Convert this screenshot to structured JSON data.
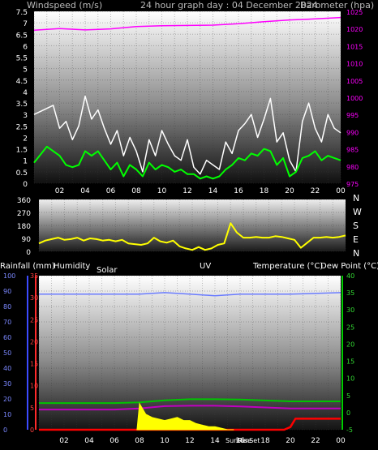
{
  "header": {
    "left": "Windspeed (m/s)",
    "center": "24 hour graph day : 04 December 2024",
    "right": "Barometer (hpa)"
  },
  "wind_panel_labels": {
    "compass": [
      "N",
      "W",
      "S",
      "E",
      "N"
    ]
  },
  "bottom_headers": {
    "rainfall": "Rainfall (mm)",
    "humidity": "Humidity",
    "solar": "Solar",
    "uv": "UV",
    "temperature": "Temperature (°C)",
    "dewpoint": "Dew Point (°C)"
  },
  "sun_labels": {
    "sunrise": "SunRise",
    "sunset": "SunSet"
  },
  "colors": {
    "wind_speed": "#ffffff",
    "wind_avg": "#00ff00",
    "barometer": "#ff00ff",
    "direction": "#ffff00",
    "humidity": "#6a7cff",
    "temperature": "#00c400",
    "dewpoint": "#c000c0",
    "rain": "#ff0000",
    "solar": "#ffff00",
    "uv": "#9aa2ff",
    "axis_left": "#ffffff",
    "axis_humidity": "#3c4bff",
    "axis_rain": "#ff2a2a",
    "axis_temp": "#00cc00"
  },
  "chart_data": [
    {
      "type": "line",
      "panel": "wind-barometer",
      "xlabel": "",
      "x_ticks": [
        "02",
        "04",
        "06",
        "08",
        "10",
        "12",
        "14",
        "16",
        "18",
        "20",
        "22",
        "00"
      ],
      "ylim_left": [
        0,
        7.5
      ],
      "y_ticks_left": [
        "0",
        "0.5",
        "1",
        "1.5",
        "2",
        "2.5",
        "3",
        "3.5",
        "4",
        "4.5",
        "5",
        "5.5",
        "6",
        "6.5",
        "7",
        "7.5"
      ],
      "ylim_right": [
        975,
        1025
      ],
      "y_ticks_right": [
        "975",
        "980",
        "985",
        "990",
        "995",
        "1000",
        "1005",
        "1010",
        "1015",
        "1020",
        "1025"
      ],
      "series": [
        {
          "key": "gust",
          "axis": "left",
          "hours": [
            0,
            1.5,
            2,
            2.5,
            3,
            3.5,
            4,
            4.5,
            5,
            5.5,
            6,
            6.5,
            7,
            7.5,
            8,
            8.5,
            9,
            9.5,
            10,
            10.5,
            11,
            11.5,
            12,
            12.5,
            13,
            13.5,
            14,
            14.5,
            15,
            15.5,
            16,
            16.5,
            17,
            17.5,
            18,
            18.5,
            19,
            19.5,
            20,
            20.5,
            21,
            21.5,
            22,
            22.5,
            23,
            23.5,
            24
          ],
          "values": [
            3.0,
            3.4,
            2.4,
            2.7,
            1.9,
            2.5,
            3.8,
            2.8,
            3.2,
            2.4,
            1.7,
            2.3,
            1.2,
            2.0,
            1.4,
            0.5,
            1.9,
            1.2,
            2.3,
            1.7,
            1.2,
            1.0,
            1.9,
            0.7,
            0.4,
            1.0,
            0.8,
            0.6,
            1.8,
            1.3,
            2.3,
            2.6,
            3.0,
            2.0,
            2.8,
            3.7,
            1.8,
            2.2,
            1.0,
            0.5,
            2.7,
            3.5,
            2.4,
            1.8,
            3.0,
            2.4,
            2.2
          ]
        },
        {
          "key": "average",
          "axis": "left",
          "hours": [
            0,
            1,
            2,
            2.5,
            3,
            3.5,
            4,
            4.5,
            5,
            5.5,
            6,
            6.5,
            7,
            7.5,
            8,
            8.5,
            9,
            9.5,
            10,
            10.5,
            11,
            11.5,
            12,
            12.5,
            13,
            13.5,
            14,
            14.5,
            15,
            15.5,
            16,
            16.5,
            17,
            17.5,
            18,
            18.5,
            19,
            19.5,
            20,
            20.5,
            21,
            21.5,
            22,
            22.5,
            23,
            23.5,
            24
          ],
          "values": [
            0.9,
            1.6,
            1.2,
            0.8,
            0.7,
            0.8,
            1.4,
            1.2,
            1.4,
            1.0,
            0.6,
            0.9,
            0.3,
            0.8,
            0.6,
            0.3,
            0.9,
            0.6,
            0.8,
            0.7,
            0.5,
            0.6,
            0.4,
            0.4,
            0.2,
            0.3,
            0.2,
            0.3,
            0.6,
            0.8,
            1.1,
            1.0,
            1.3,
            1.2,
            1.5,
            1.4,
            0.8,
            1.1,
            0.3,
            0.5,
            1.1,
            1.2,
            1.4,
            1.0,
            1.2,
            1.1,
            1.0
          ]
        },
        {
          "key": "barometer",
          "axis": "right",
          "hours": [
            0,
            2,
            4,
            6,
            8,
            10,
            12,
            14,
            16,
            18,
            20,
            22,
            24
          ],
          "values": [
            1019.5,
            1020.0,
            1019.6,
            1019.9,
            1020.6,
            1020.8,
            1020.9,
            1021.0,
            1021.4,
            1022.0,
            1022.5,
            1022.8,
            1023.2
          ]
        }
      ]
    },
    {
      "type": "line",
      "panel": "wind-direction",
      "ylim": [
        0,
        360
      ],
      "y_ticks": [
        "0",
        "90",
        "180",
        "270",
        "360"
      ],
      "x_ticks": [],
      "series": [
        {
          "key": "direction",
          "hours": [
            0,
            0.5,
            1,
            1.5,
            2,
            2.5,
            3,
            3.5,
            4,
            4.5,
            5,
            5.5,
            6,
            6.5,
            7,
            7.5,
            8,
            8.5,
            9,
            9.5,
            10,
            10.5,
            11,
            11.5,
            12,
            12.5,
            13,
            13.5,
            14,
            14.5,
            15,
            15.5,
            16,
            16.5,
            17,
            17.5,
            18,
            18.5,
            19,
            19.5,
            20,
            20.5,
            21,
            21.5,
            22,
            22.5,
            23,
            23.5,
            24
          ],
          "values": [
            55,
            75,
            85,
            95,
            80,
            85,
            95,
            75,
            90,
            85,
            75,
            80,
            70,
            80,
            55,
            50,
            45,
            55,
            95,
            70,
            60,
            75,
            35,
            20,
            10,
            30,
            10,
            20,
            45,
            55,
            195,
            130,
            95,
            95,
            100,
            95,
            95,
            105,
            100,
            90,
            80,
            25,
            60,
            95,
            95,
            100,
            95,
            100,
            110
          ]
        }
      ]
    },
    {
      "type": "line",
      "panel": "climate",
      "x_ticks": [
        "02",
        "04",
        "06",
        "08",
        "10",
        "12",
        "14",
        "16",
        "18",
        "20",
        "22",
        "00"
      ],
      "ylim_humidity": [
        0,
        100
      ],
      "y_ticks_humidity": [
        "0",
        "10",
        "20",
        "30",
        "40",
        "50",
        "60",
        "70",
        "80",
        "90",
        "100"
      ],
      "ylim_rain": [
        0,
        35
      ],
      "y_ticks_rain": [
        "0",
        "5",
        "10",
        "15",
        "20",
        "25",
        "30",
        "35"
      ],
      "ylim_temp": [
        -5,
        40
      ],
      "y_ticks_temp": [
        "-5",
        "0",
        "5",
        "10",
        "15",
        "20",
        "25",
        "30",
        "35",
        "40"
      ],
      "series": [
        {
          "key": "humidity",
          "axis": "humidity",
          "hours": [
            0,
            4,
            8,
            10,
            12,
            14,
            16,
            20,
            24
          ],
          "values": [
            88,
            88,
            88,
            89,
            88,
            87,
            88,
            88,
            89
          ]
        },
        {
          "key": "temperature",
          "axis": "temp",
          "hours": [
            0,
            6,
            8,
            10,
            12,
            14,
            16,
            20,
            22,
            24
          ],
          "values": [
            2.8,
            2.8,
            3.0,
            3.6,
            3.9,
            3.9,
            3.8,
            3.3,
            3.3,
            3.3
          ]
        },
        {
          "key": "dewpoint",
          "axis": "temp",
          "hours": [
            0,
            6,
            8,
            10,
            12,
            14,
            16,
            20,
            22,
            24
          ],
          "values": [
            0.9,
            0.9,
            1.2,
            1.9,
            2.0,
            2.0,
            1.8,
            1.2,
            1.2,
            1.2
          ]
        },
        {
          "key": "rain",
          "axis": "rain",
          "hours": [
            0,
            19.5,
            20,
            20.4,
            24
          ],
          "values": [
            0,
            0,
            0.6,
            2.5,
            2.5
          ]
        },
        {
          "key": "solar",
          "axis": "humidity",
          "hours": [
            7.8,
            8,
            8.5,
            9,
            9.5,
            10,
            10.5,
            11,
            11.5,
            12,
            12.5,
            13,
            13.5,
            14,
            14.5,
            15,
            15.5
          ],
          "values": [
            0,
            17,
            10,
            8,
            7,
            6,
            7,
            8,
            6,
            6,
            4,
            3,
            2,
            2,
            1,
            0,
            0
          ]
        }
      ]
    }
  ]
}
